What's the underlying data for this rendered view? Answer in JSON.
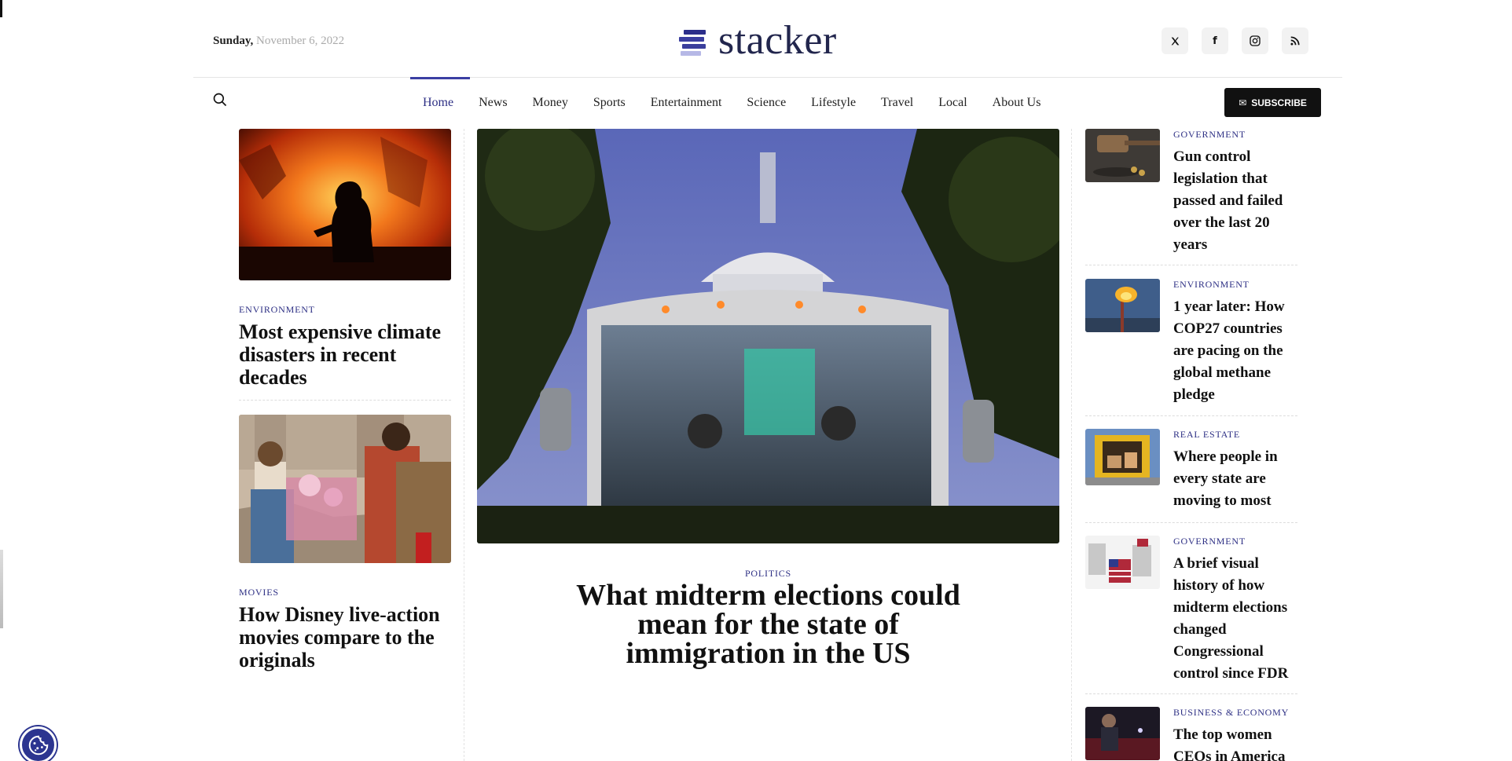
{
  "date": {
    "day": "Sunday,",
    "full": "November 6, 2022"
  },
  "brand": {
    "name": "stacker"
  },
  "social": [
    {
      "icon": "twitter-icon",
      "glyph": "𝕏"
    },
    {
      "icon": "facebook-icon",
      "glyph": "f"
    },
    {
      "icon": "instagram-icon",
      "glyph": "◎"
    },
    {
      "icon": "rss-icon",
      "glyph": "⌇"
    }
  ],
  "nav": {
    "items": [
      "Home",
      "News",
      "Money",
      "Sports",
      "Entertainment",
      "Science",
      "Lifestyle",
      "Travel",
      "Local",
      "About Us"
    ],
    "active": "Home"
  },
  "subscribe": {
    "label": "SUBSCRIBE"
  },
  "left_articles": [
    {
      "category": "ENVIRONMENT",
      "title": "Most expensive climate disasters in recent decades"
    },
    {
      "category": "MOVIES",
      "title": "How Disney live-action movies compare to the originals"
    }
  ],
  "hero": {
    "category": "POLITICS",
    "title": "What midterm elections could mean for the state of immigration in the US"
  },
  "right_articles": [
    {
      "category": "GOVERNMENT",
      "title": "Gun control legislation that passed and failed over the last 20 years"
    },
    {
      "category": "ENVIRONMENT",
      "title": "1 year later: How COP27 countries are pacing on the global methane pledge"
    },
    {
      "category": "REAL ESTATE",
      "title": "Where people in every state are moving to most"
    },
    {
      "category": "GOVERNMENT",
      "title": "A brief visual history of how midterm elections changed Congressional control since FDR"
    },
    {
      "category": "BUSINESS & ECONOMY",
      "title": "The top women CEOs in America"
    }
  ],
  "colors": {
    "accent": "#2d2f84",
    "subscribe_bg": "#111111",
    "cookie_bg": "#2c3590"
  }
}
